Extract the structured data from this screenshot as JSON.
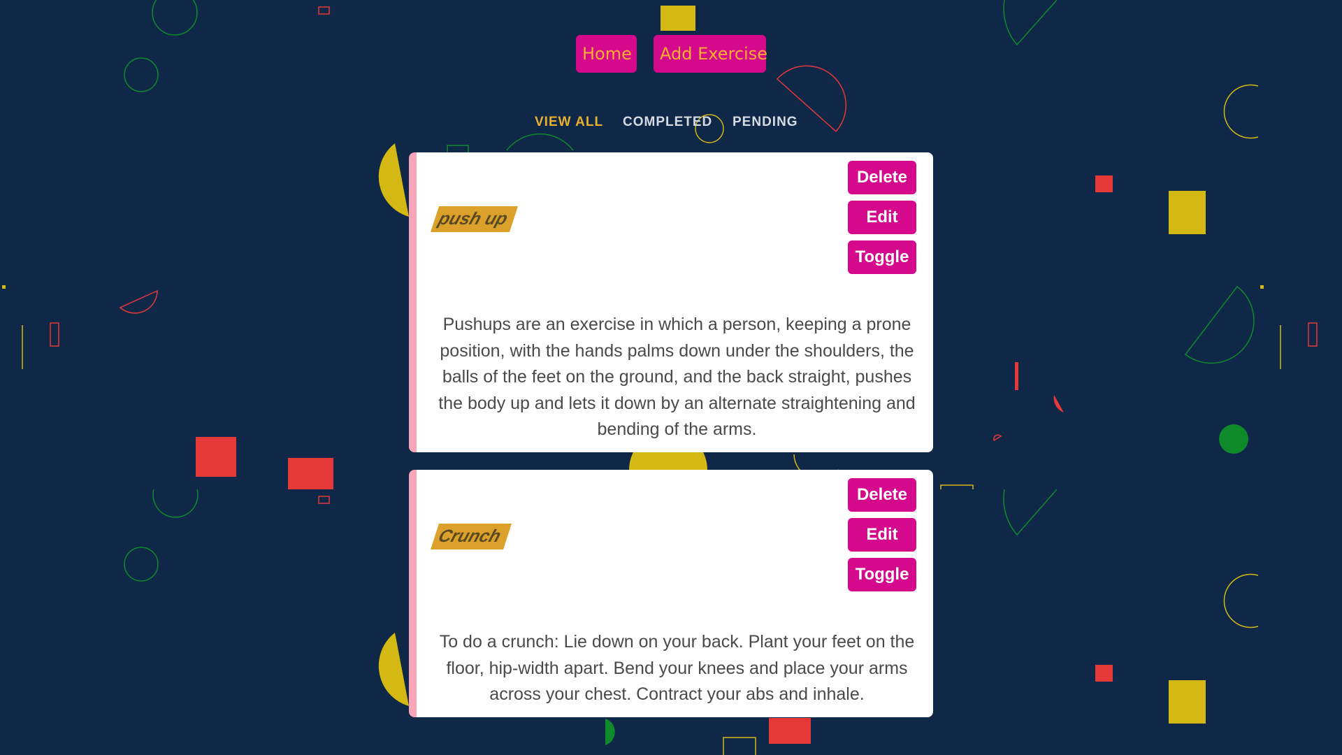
{
  "nav": {
    "home_label": "Home",
    "add_label": "Add Exercise"
  },
  "filters": {
    "all": "VIEW ALL",
    "completed": "COMPLETED",
    "pending": "PENDING",
    "active": "VIEW ALL"
  },
  "exercises": [
    {
      "title": "push up",
      "description": "Pushups are an exercise in which a person, keeping a prone position, with the hands palms down under the shoulders, the balls of the feet on the ground, and the back straight, pushes the body up and lets it down by an alternate straightening and bending of the arms.",
      "delete_label": "Delete",
      "edit_label": "Edit",
      "toggle_label": "Toggle"
    },
    {
      "title": "Crunch",
      "description": "To do a crunch: Lie down on your back. Plant your feet on the floor, hip-width apart. Bend your knees and place your arms across your chest. Contract your abs and inhale.",
      "delete_label": "Delete",
      "edit_label": "Edit",
      "toggle_label": "Toggle"
    }
  ],
  "colors": {
    "background": "#102848",
    "button": "#d4098c",
    "nav_text": "#ffb02e",
    "filter_active": "#e8b12e",
    "card_accent": "#f7a6b9",
    "title_tag": "#dca12b"
  }
}
